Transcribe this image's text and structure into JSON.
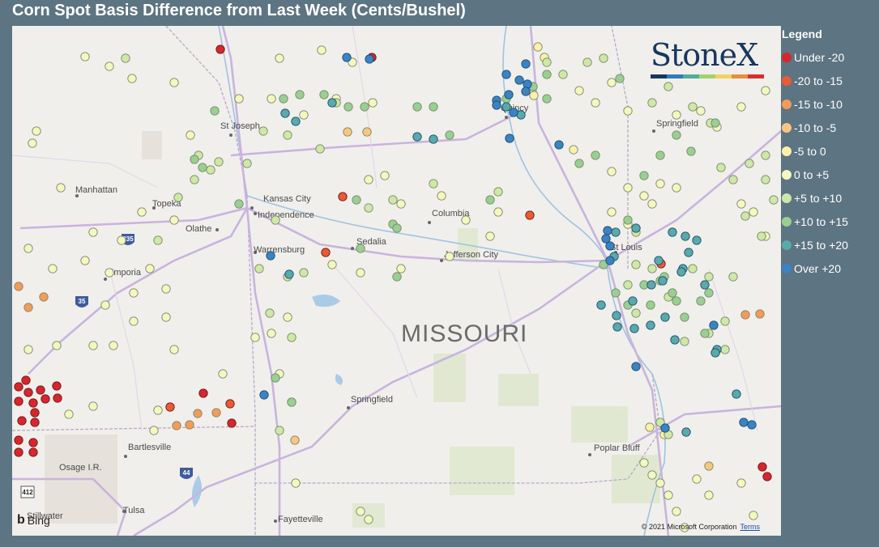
{
  "title": "Corn Spot Basis Difference from Last Week (Cents/Bushel)",
  "map": {
    "state_label": "MISSOURI",
    "cities": [
      "St Joseph",
      "Manhattan",
      "Topeka",
      "Kansas City",
      "Independence",
      "Olathe",
      "Warrensburg",
      "Sedalia",
      "Columbia",
      "Jefferson City",
      "Emporia",
      "St Louis",
      "Springfield",
      "Springfield",
      "Quincy",
      "Bartlesville",
      "Osage I.R.",
      "Poplar Bluff",
      "Tulsa",
      "Stillwater",
      "Fayetteville"
    ],
    "highway_shields": [
      "335",
      "35",
      "44",
      "412"
    ],
    "attribution": {
      "provider": "Bing",
      "copyright": "© 2021 Microsoft Corporation",
      "terms": "Terms"
    }
  },
  "logo": {
    "text": "StoneX",
    "colors": [
      "#17375e",
      "#2e7dbf",
      "#4fae9c",
      "#a6cf73",
      "#f2d35b",
      "#eb8d3a",
      "#d92e2e"
    ]
  },
  "legend": {
    "title": "Legend",
    "items": [
      {
        "label": "Under -20",
        "color": "#d7262d"
      },
      {
        "label": "-20 to -15",
        "color": "#ea5a34"
      },
      {
        "label": "-15 to -10",
        "color": "#f59a58"
      },
      {
        "label": "-10 to -5",
        "color": "#fbc57f"
      },
      {
        "label": "-5 to 0",
        "color": "#fdf0a8"
      },
      {
        "label": "0 to +5",
        "color": "#f3f8c0"
      },
      {
        "label": "+5 to +10",
        "color": "#cfe8a7"
      },
      {
        "label": "+10 to +15",
        "color": "#99cf92"
      },
      {
        "label": "+15 to +20",
        "color": "#5aa9ab"
      },
      {
        "label": "Over +20",
        "color": "#3a83c4"
      }
    ]
  }
}
